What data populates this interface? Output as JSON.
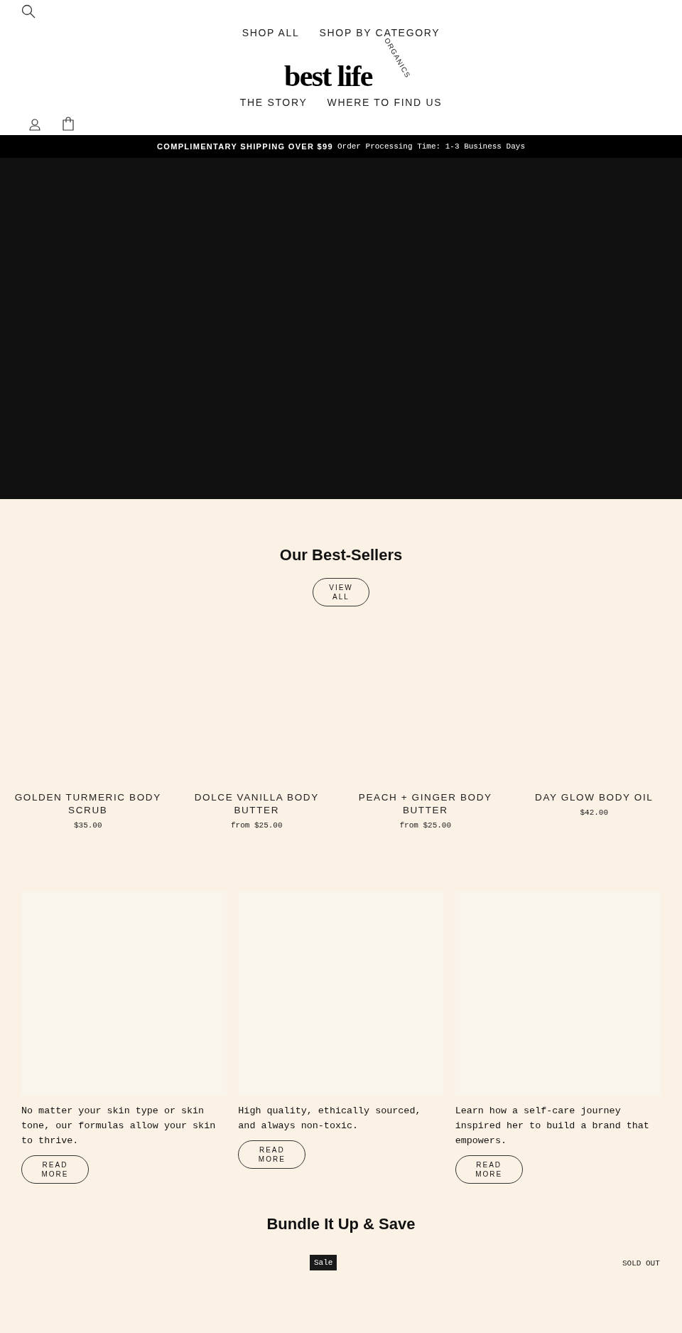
{
  "header": {
    "nav_top": [
      "SHOP ALL",
      "SHOP BY CATEGORY"
    ],
    "logo": {
      "wordmark": "best life",
      "tagline": "ORGANICS"
    },
    "nav_bottom": [
      "THE STORY",
      "WHERE TO FIND US"
    ]
  },
  "announcement": {
    "bold": "COMPLIMENTARY SHIPPING OVER $99",
    "text": "Order Processing Time: 1-3 Business Days"
  },
  "best_sellers": {
    "title": "Our Best-Sellers",
    "button": "VIEW ALL",
    "products": [
      {
        "name": "GOLDEN TURMERIC BODY SCRUB",
        "price": "$35.00"
      },
      {
        "name": "DOLCE VANILLA BODY BUTTER",
        "price": "from $25.00"
      },
      {
        "name": "PEACH + GINGER BODY BUTTER",
        "price": "from $25.00"
      },
      {
        "name": "DAY GLOW BODY OIL",
        "price": "$42.00"
      }
    ]
  },
  "articles": [
    {
      "text": "No matter your skin type or skin tone, our formulas allow your skin to thrive.",
      "button": "READ MORE"
    },
    {
      "text": "High quality, ethically sourced, and always non-toxic.",
      "button": "READ MORE"
    },
    {
      "text": "Learn how a self-care journey inspired her to build a brand that empowers.",
      "button": "READ MORE"
    }
  ],
  "bundle": {
    "title": "Bundle It Up & Save",
    "sale_badge": "Sale",
    "sold_out": "SOLD OUT"
  }
}
